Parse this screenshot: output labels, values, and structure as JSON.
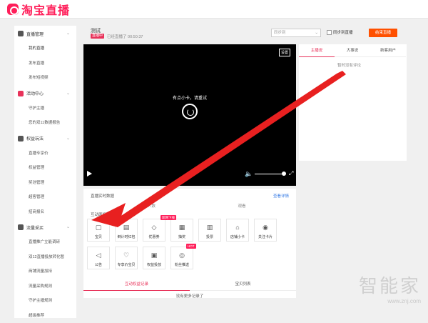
{
  "brand": {
    "logo_text": "淘宝直播",
    "color": "#ff1f5a"
  },
  "sidebar": {
    "sections": [
      {
        "label": "直播管理",
        "icon": "video-icon",
        "items": [
          "我的直播",
          "发布直播",
          "发布短视频"
        ]
      },
      {
        "label": "活动中心",
        "icon": "activity-icon",
        "items": [
          "守护主播",
          "您的双11数据报告"
        ]
      },
      {
        "label": "权益玩法",
        "icon": "rights-icon",
        "items": [
          "直播专享价",
          "权益管理",
          "奖池管理",
          "超客管理",
          "招商报名"
        ]
      },
      {
        "label": "流量采买",
        "icon": "traffic-icon",
        "items": [
          "直播推广立能调研",
          "双12直播投放转化暂",
          "商铺流量加持",
          "流量采购规则",
          "守护主播规则",
          "超级推荐"
        ]
      }
    ]
  },
  "header": {
    "stream_title": "测试",
    "live_tag": "直播中",
    "live_time": "已经直播了 00:50:37",
    "mode_select": "同步到",
    "checkbox_label": "同步到直播",
    "end_button": "结束直播"
  },
  "video": {
    "settings": "设置",
    "message": "有点小卡，请重试"
  },
  "right_panel": {
    "tabs": [
      "主播说",
      "大事说",
      "新客用户"
    ],
    "empty_text": "暂时没有评论"
  },
  "stats": {
    "title": "直播实时数据",
    "link": "查看详情",
    "items": [
      {
        "label": "在线人数",
        "value": ""
      },
      {
        "label": "观看",
        "value": "0"
      }
    ]
  },
  "interact": {
    "title": "互动面板",
    "tools": [
      {
        "label": "宝贝",
        "icon": "item-icon"
      },
      {
        "label": "倒计时红包",
        "icon": "countdown-redpacket-icon"
      },
      {
        "label": "优惠券",
        "icon": "coupon-icon"
      },
      {
        "label": "抽奖",
        "icon": "lottery-icon",
        "badge": "新网下线"
      },
      {
        "label": "投票",
        "icon": "vote-icon"
      },
      {
        "label": "店铺小卡",
        "icon": "shop-card-icon"
      },
      {
        "label": "关注卡片",
        "icon": "follow-card-icon"
      },
      {
        "label": "公告",
        "icon": "announcement-icon"
      },
      {
        "label": "专享价宝贝",
        "icon": "exclusive-price-icon"
      },
      {
        "label": "权益投放",
        "icon": "rights-delivery-icon"
      },
      {
        "label": "粉丝推送",
        "icon": "fan-push-icon",
        "badge": "HOT"
      }
    ]
  },
  "records": {
    "tabs": [
      "互动权益记录",
      "宝贝列表"
    ],
    "empty_text": "没有更多记录了"
  },
  "watermark": {
    "text": "智能家",
    "url": "www.znj.com"
  }
}
